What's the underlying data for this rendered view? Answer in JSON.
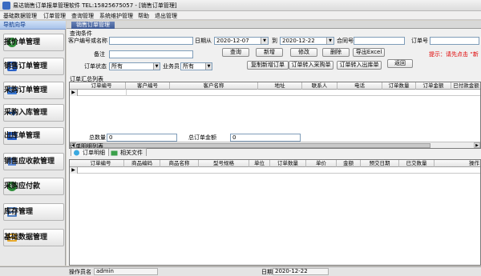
{
  "window": {
    "title": "易达销售订单报单管理软件 TEL:15825675057 - [销售订单管理]"
  },
  "menu": [
    "基础数据管理",
    "订单管理",
    "查询管理",
    "系统维护管理",
    "帮助",
    "退出管理"
  ],
  "sidebar": {
    "title": "导航向导",
    "items": [
      {
        "label": "报价单管理",
        "icon": "price-icon"
      },
      {
        "label": "销售订单管理",
        "icon": "order-icon"
      },
      {
        "label": "采购订单管理",
        "icon": "purchase-icon"
      },
      {
        "label": "采购入库管理",
        "icon": "stock-in-icon"
      },
      {
        "label": "出库单管理",
        "icon": "stock-out-icon"
      },
      {
        "label": "销售应收款管理",
        "icon": "receivable-icon"
      },
      {
        "label": "采购应付款",
        "icon": "payable-icon"
      },
      {
        "label": "库存管理",
        "icon": "inventory-icon"
      },
      {
        "label": "基础数据管理",
        "icon": "database-icon"
      }
    ]
  },
  "tab": {
    "label": "销售订单管理"
  },
  "query": {
    "group_label": "查询条件",
    "order_no_or_name_label": "客户编号或名称",
    "order_no_or_name_value": "",
    "date_from_label": "日期从",
    "date_from_value": "2020-12-07",
    "date_to_label": "到",
    "date_to_value": "2020-12-22",
    "contract_label": "合同号",
    "contract_value": "",
    "order_no_label": "订单号",
    "order_no_value": "",
    "remark_label": "备注",
    "remark_value": "",
    "status_label": "订单状态",
    "status_value": "所有",
    "salesman_label": "业务员",
    "salesman_value": "所有",
    "hint": "提示：请先点击 “新"
  },
  "buttons": {
    "query": "查询",
    "add": "新增",
    "edit": "修改",
    "delete": "删除",
    "export_excel": "导出Excel",
    "copy_add": "复制新增订单",
    "to_purchase": "订单转入采购单",
    "to_outbound": "订单转入出库单",
    "back": "返回"
  },
  "summary_grid": {
    "group_label": "订单汇总列表",
    "columns": [
      "订单编号",
      "客户编号",
      "客户名称",
      "地址",
      "联系人",
      "电话",
      "订单数量",
      "订单金额",
      "已付款金额"
    ]
  },
  "totals": {
    "qty_label": "总数量",
    "qty_value": "0",
    "amount_label": "总订单金额",
    "amount_value": "0"
  },
  "detail": {
    "group_label": "订单明细列表",
    "tabs": [
      "订单明细",
      "相关文件"
    ],
    "columns": [
      "订单编号",
      "商品编码",
      "商品名称",
      "型号规格",
      "单位",
      "订单数量",
      "单价",
      "金额",
      "预交日期",
      "已交数量",
      "操作"
    ]
  },
  "status": {
    "operator_label": "操作员名",
    "operator_value": "admin",
    "date_label": "日期",
    "date_value": "2020-12-22"
  },
  "colors": {
    "hint": "#e00000",
    "tab_bg": "#3e5a96",
    "nav_title": "#0b3a8b"
  }
}
